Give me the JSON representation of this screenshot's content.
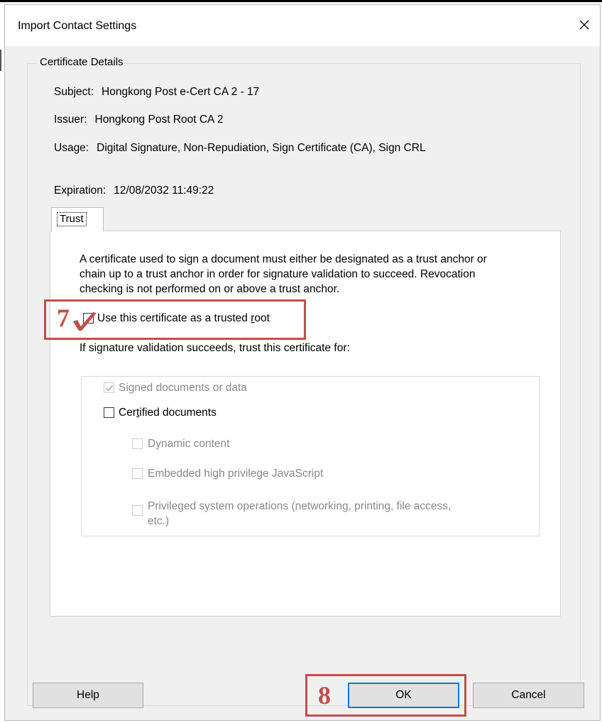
{
  "dialog": {
    "title": "Import Contact Settings",
    "close_icon": "close-icon"
  },
  "certificate_details": {
    "legend": "Certificate Details",
    "subject_label": "Subject:",
    "subject_value": "Hongkong Post e-Cert CA 2 - 17",
    "issuer_label": "Issuer:",
    "issuer_value": "Hongkong Post Root CA 2",
    "usage_label": "Usage:",
    "usage_value": "Digital Signature, Non-Repudiation, Sign Certificate (CA), Sign CRL",
    "expiration_label": "Expiration:",
    "expiration_value": "12/08/2032 11:49:22"
  },
  "tabs": [
    {
      "label": "Trust",
      "selected": true
    }
  ],
  "trust": {
    "description_line1": "A certificate used to sign a document must either be designated as a trust anchor or",
    "description_line2": "chain up to a trust anchor in order for signature validation to succeed.  Revocation",
    "description_line3": "checking is not performed on or above a trust anchor.",
    "trusted_root_pre": "Use this certificate as a trusted ",
    "trusted_root_u": "r",
    "trusted_root_post": "oot",
    "trusted_root_checked": false,
    "trust_for_label": "If signature validation succeeds, trust this certificate for:",
    "options": {
      "signed_docs": {
        "label": "Signed documents or data",
        "checked": true,
        "enabled": false
      },
      "certified_docs_pre": "Cer",
      "certified_docs_u": "t",
      "certified_docs_post": "ified documents",
      "certified_docs_checked": false,
      "dynamic_content": {
        "label": "Dynamic content",
        "checked": false,
        "enabled": false
      },
      "embedded_js": {
        "label": "Embedded high privilege JavaScript",
        "checked": false,
        "enabled": false
      },
      "privileged_ops_line1": "Privileged system operations (networking, printing, file access,",
      "privileged_ops_line2": "etc.)"
    }
  },
  "annotations": {
    "step7": "7",
    "step8": "8",
    "color": "#c0504d"
  },
  "buttons": {
    "help": "Help",
    "ok": "OK",
    "cancel": "Cancel"
  },
  "colors": {
    "dialog_bg": "#f0f0f0",
    "default_button_border": "#0078d7"
  }
}
